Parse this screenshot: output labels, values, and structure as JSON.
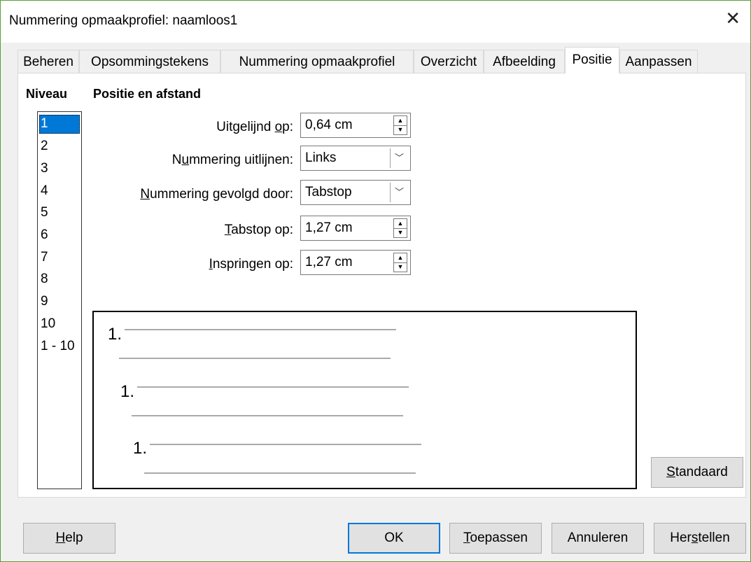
{
  "window": {
    "title": "Nummering opmaakprofiel: naamloos1",
    "close_glyph": "✕"
  },
  "tabs": [
    {
      "label": "Beheren"
    },
    {
      "label": "Opsommingstekens"
    },
    {
      "label": "Nummering opmaakprofiel"
    },
    {
      "label": "Overzicht"
    },
    {
      "label": "Afbeelding"
    },
    {
      "label": "Positie",
      "active": true
    },
    {
      "label": "Aanpassen"
    }
  ],
  "level_section": {
    "heading": "Niveau",
    "items": [
      "1",
      "2",
      "3",
      "4",
      "5",
      "6",
      "7",
      "8",
      "9",
      "10",
      "1 - 10"
    ],
    "selected": "1"
  },
  "position": {
    "heading": "Positie en afstand",
    "aligned_at": {
      "label_pre": "Uitgelijnd ",
      "label_u": "o",
      "label_post": "p:",
      "value": "0,64 cm"
    },
    "numbering_align": {
      "label_pre": "N",
      "label_u": "u",
      "label_post": "mmering uitlijnen:",
      "value": "Links"
    },
    "followed_by": {
      "label_pre": "",
      "label_u": "N",
      "label_post": "ummering gevolgd door:",
      "value": "Tabstop"
    },
    "tab_stop_at": {
      "label_pre": "",
      "label_u": "T",
      "label_post": "abstop op:",
      "value": "1,27 cm"
    },
    "indent_at": {
      "label_pre": "",
      "label_u": "I",
      "label_post": "nspringen op:",
      "value": "1,27 cm"
    }
  },
  "preview": {
    "number_label": "1."
  },
  "buttons": {
    "standaard": {
      "pre": "",
      "u": "S",
      "post": "tandaard"
    },
    "help": {
      "pre": "",
      "u": "H",
      "post": "elp"
    },
    "ok": {
      "label": "OK"
    },
    "toepassen": {
      "pre": "",
      "u": "T",
      "post": "oepassen"
    },
    "annuleren": {
      "label": "Annuleren"
    },
    "herstellen": {
      "pre": "Her",
      "u": "s",
      "post": "tellen"
    }
  },
  "icons": {
    "spin_up": "▲",
    "spin_down": "▼",
    "dropdown": "﹀"
  }
}
